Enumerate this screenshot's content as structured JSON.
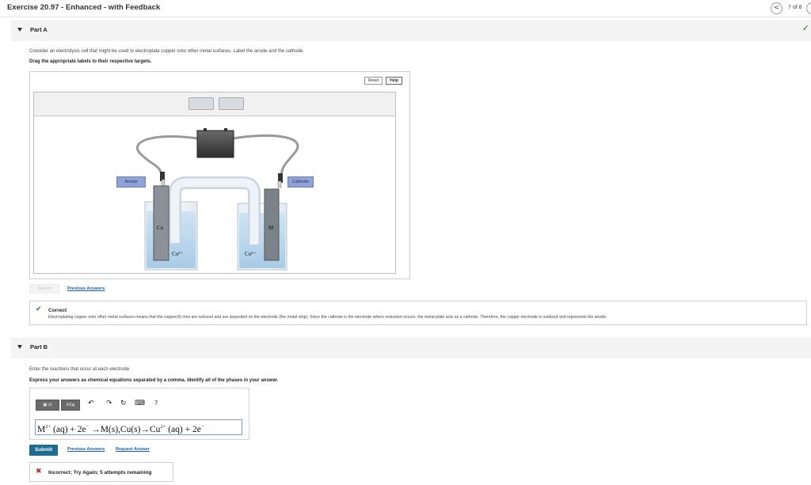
{
  "header": {
    "title": "Exercise 20.97 - Enhanced - with Feedback",
    "nav_prev_symbol": "<",
    "counter": "7 of 8"
  },
  "partA": {
    "label": "Part A",
    "question": "Consider an electrolysis cell that might be used to electroplate copper onto other metal surfaces. Label the anode and the cathode.",
    "instruction": "Drag the appropriate labels to their respective targets.",
    "reset_label": "Reset",
    "help_label": "Help",
    "diagram": {
      "anode_label": "Anode",
      "cathode_label": "Cathode",
      "left_electrode": "Cu",
      "right_electrode": "M",
      "left_ion": "Cu²⁺",
      "right_ion": "Cu²⁺"
    },
    "submit_label": "Submit",
    "previous_answers": "Previous Answers",
    "feedback_title": "Correct",
    "feedback_text": "Electroplating copper onto other metal surfaces means that the copper(II) ions are reduced and are deposited on the electrode (the metal strip). Since the cathode is the electrode where reduction occurs, the metal plate acts as a cathode. Therefore, the copper electrode is oxidized and represents the anode."
  },
  "partB": {
    "label": "Part B",
    "question": "Enter the reactions that occur at each electrode.",
    "instruction": "Express your answers as chemical equations separated by a comma. Identify all of the phases in your answer.",
    "toolbar_greek": "ΑΣφ",
    "help_symbol": "?",
    "answer": {
      "p1": "M",
      "s1": "2+",
      "p2": " (aq) + 2e",
      "s2": "−",
      "p3": " →M(s),Cu(s)→Cu",
      "s3": "2+",
      "p4": " (aq) + 2e",
      "s4": "−"
    },
    "submit_label": "Submit",
    "previous_answers": "Previous Answers",
    "request_answer": "Request Answer",
    "result_text": "Incorrect; Try Again; 5 attempts remaining"
  }
}
